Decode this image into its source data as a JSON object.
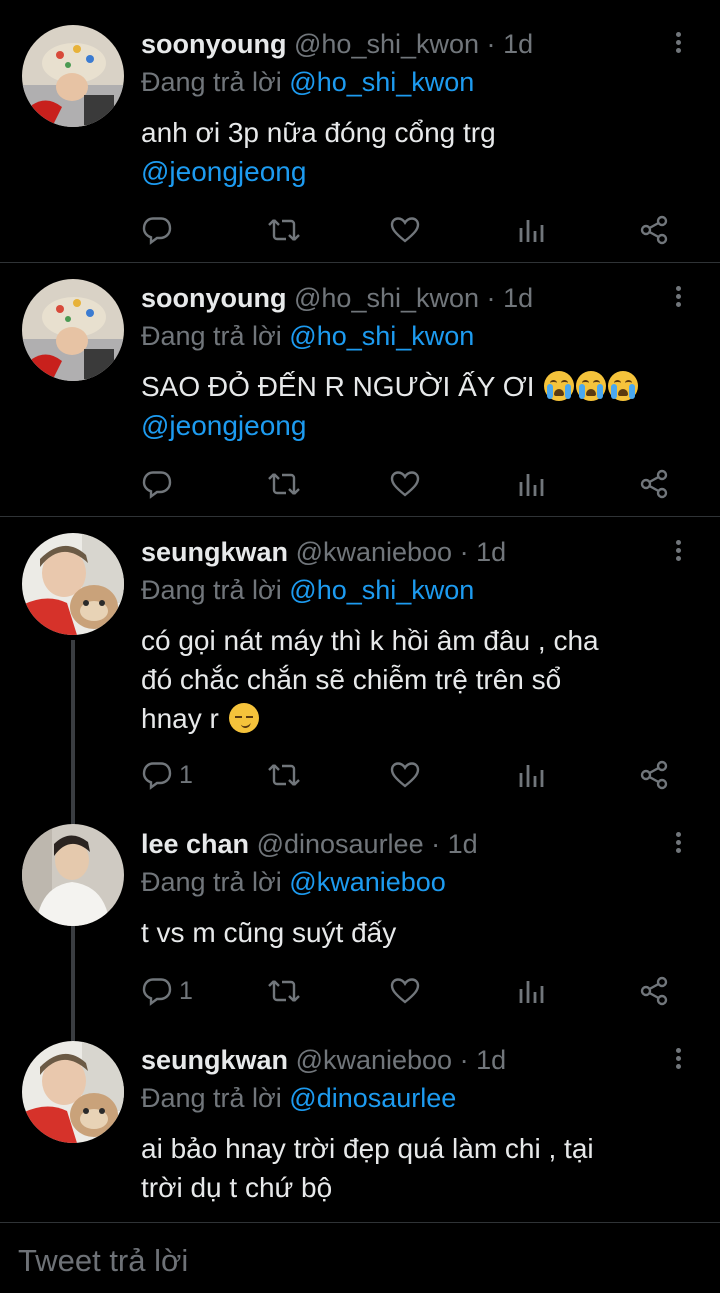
{
  "tweets": [
    {
      "display_name": "soonyoung",
      "handle": "@ho_shi_kwon",
      "time": "1d",
      "reply_prefix": "Đang trả lời",
      "reply_to": "@ho_shi_kwon",
      "text_line1": "anh ơi  3p nữa đóng cổng trg",
      "text_mention": "@jeongjeong",
      "reply_count": "",
      "avatar": "hoshi-avatar"
    },
    {
      "display_name": "soonyoung",
      "handle": "@ho_shi_kwon",
      "time": "1d",
      "reply_prefix": "Đang trả lời",
      "reply_to": "@ho_shi_kwon",
      "text_line1": "SAO ĐỎ ĐẾN R NGƯỜI ẤY ƠI",
      "text_emoji": "crying-face x3",
      "text_mention": "@jeongjeong",
      "reply_count": "",
      "avatar": "hoshi-avatar"
    },
    {
      "display_name": "seungkwan",
      "handle": "@kwanieboo",
      "time": "1d",
      "reply_prefix": "Đang trả lời",
      "reply_to": "@ho_shi_kwon",
      "text_line1": "có gọi nát máy thì k hồi âm đâu , cha",
      "text_line2": "đó chắc chắn sẽ chiễm trệ trên sổ",
      "text_line3": "hnay r",
      "text_emoji": "smirking-face",
      "reply_count": "1",
      "avatar": "seungkwan-avatar"
    },
    {
      "display_name": "lee chan",
      "handle": "@dinosaurlee",
      "time": "1d",
      "reply_prefix": "Đang trả lời",
      "reply_to": "@kwanieboo",
      "text_line1": "t vs m cũng suýt đấy",
      "reply_count": "1",
      "avatar": "leechan-avatar"
    },
    {
      "display_name": "seungkwan",
      "handle": "@kwanieboo",
      "time": "1d",
      "reply_prefix": "Đang trả lời",
      "reply_to": "@dinosaurlee",
      "text_line1": "ai bảo hnay trời đẹp quá làm chi , tại",
      "text_line2": "trời dụ t chứ bộ",
      "avatar": "seungkwan-avatar"
    }
  ],
  "meta_separator": "·",
  "compose": {
    "placeholder": "Tweet trả lời"
  },
  "icons": [
    "reply-icon",
    "retweet-icon",
    "like-icon",
    "analytics-icon",
    "share-icon",
    "more-icon"
  ],
  "colors": {
    "background": "#000000",
    "mention": "#1d9bf0",
    "muted": "#71767b",
    "text": "#e7e9ea"
  }
}
